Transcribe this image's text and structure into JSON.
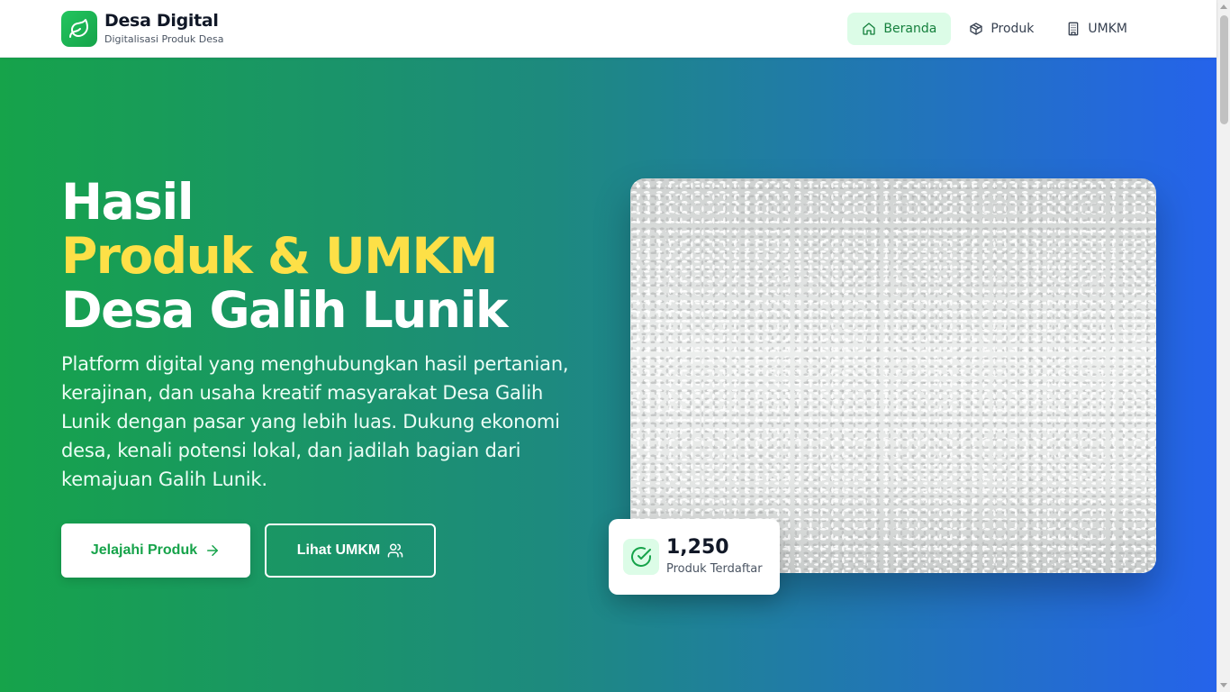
{
  "brand": {
    "title": "Desa Digital",
    "subtitle": "Digitalisasi Produk Desa",
    "logo_icon": "leaf-icon"
  },
  "nav": {
    "items": [
      {
        "label": "Beranda",
        "icon": "home-icon",
        "active": true
      },
      {
        "label": "Produk",
        "icon": "box-icon",
        "active": false
      },
      {
        "label": "UMKM",
        "icon": "building-icon",
        "active": false
      }
    ]
  },
  "hero": {
    "title_line1": "Hasil",
    "title_line2": "Produk & UMKM",
    "title_line3": "Desa Galih Lunik",
    "description": "Platform digital yang menghubungkan hasil pertanian, kerajinan, dan usaha kreatif masyarakat Desa Galih Lunik dengan pasar yang lebih luas. Dukung ekonomi desa, kenali potensi lokal, dan jadilah bagian dari kemajuan Galih Lunik.",
    "primary_button": "Jelajahi Produk",
    "secondary_button": "Lihat UMKM",
    "image_subject": "rice-grains-photo"
  },
  "stat": {
    "value": "1,250",
    "label": "Produk Terdaftar",
    "icon": "check-circle-icon"
  },
  "colors": {
    "brand_green": "#16a34a",
    "accent_yellow": "#fde047",
    "gradient_start": "#16a34a",
    "gradient_end": "#2563eb",
    "nav_active_bg": "#dcfce7"
  }
}
